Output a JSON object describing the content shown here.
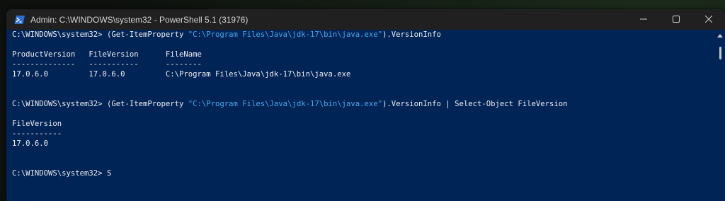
{
  "window": {
    "title": "Admin: C:\\WINDOWS\\system32 - PowerShell 5.1 (31976)",
    "icon": "powershell-icon",
    "background_color": "#012456"
  },
  "caption_buttons": {
    "minimize_icon": "minimize-icon",
    "maximize_icon": "maximize-icon",
    "close_icon": "close-icon"
  },
  "console": {
    "cmd1": {
      "prompt": "C:\\WINDOWS\\system32> ",
      "pre": "(Get-ItemProperty ",
      "path": "\"C:\\Program Files\\Java\\jdk-17\\bin\\java.exe\"",
      "post": ").VersionInfo"
    },
    "table1": {
      "header": "ProductVersion   FileVersion      FileName",
      "divider": "--------------   -----------      --------",
      "row": "17.0.6.0         17.0.6.0         C:\\Program Files\\Java\\jdk-17\\bin\\java.exe"
    },
    "cmd2": {
      "prompt": "C:\\WINDOWS\\system32> ",
      "pre": "(Get-ItemProperty ",
      "path": "\"C:\\Program Files\\Java\\jdk-17\\bin\\java.exe\"",
      "post": ").VersionInfo | Select-Object FileVersion"
    },
    "table2": {
      "header": "FileVersion",
      "divider": "-----------",
      "row": "17.0.6.0"
    },
    "cmd3": {
      "prompt": "C:\\WINDOWS\\system32> ",
      "input": "S"
    },
    "string_color": "#4ca6ea",
    "text_color": "#eeedf0"
  }
}
